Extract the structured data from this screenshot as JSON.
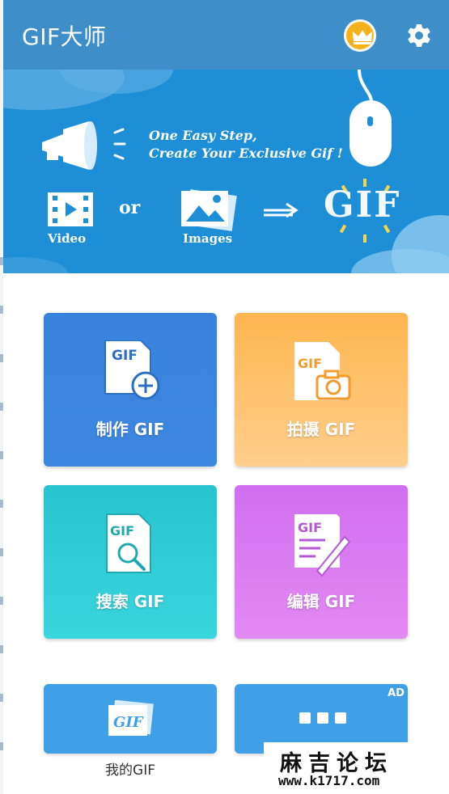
{
  "app": {
    "title": "GIF大师",
    "header_color": "#3d8ec9",
    "icons": {
      "vip": "crown-icon",
      "settings": "gear-icon"
    }
  },
  "banner": {
    "line1": "One Easy Step,",
    "line2": "Create Your Exclusive Gif !",
    "video_label": "Video",
    "or_label": "or",
    "images_label": "Images",
    "gif_text": "GIF"
  },
  "tiles": [
    {
      "id": "make",
      "label": "制作 GIF",
      "icon_text": "GIF",
      "color": "#3a83dd"
    },
    {
      "id": "shoot",
      "label": "拍摄 GIF",
      "icon_text": "GIF",
      "color": "#ffb54f"
    },
    {
      "id": "search",
      "label": "搜索 GIF",
      "icon_text": "GIF",
      "color": "#27c4cf"
    },
    {
      "id": "edit",
      "label": "编辑 GIF",
      "icon_text": "GIF",
      "color": "#cf6ef0"
    }
  ],
  "bottom": {
    "my_gif_label": "我的GIF",
    "my_gif_icon_text": "GIF",
    "ad_badge": "AD"
  },
  "watermark": {
    "title": "麻吉论坛",
    "url": "www.k1717.com"
  }
}
